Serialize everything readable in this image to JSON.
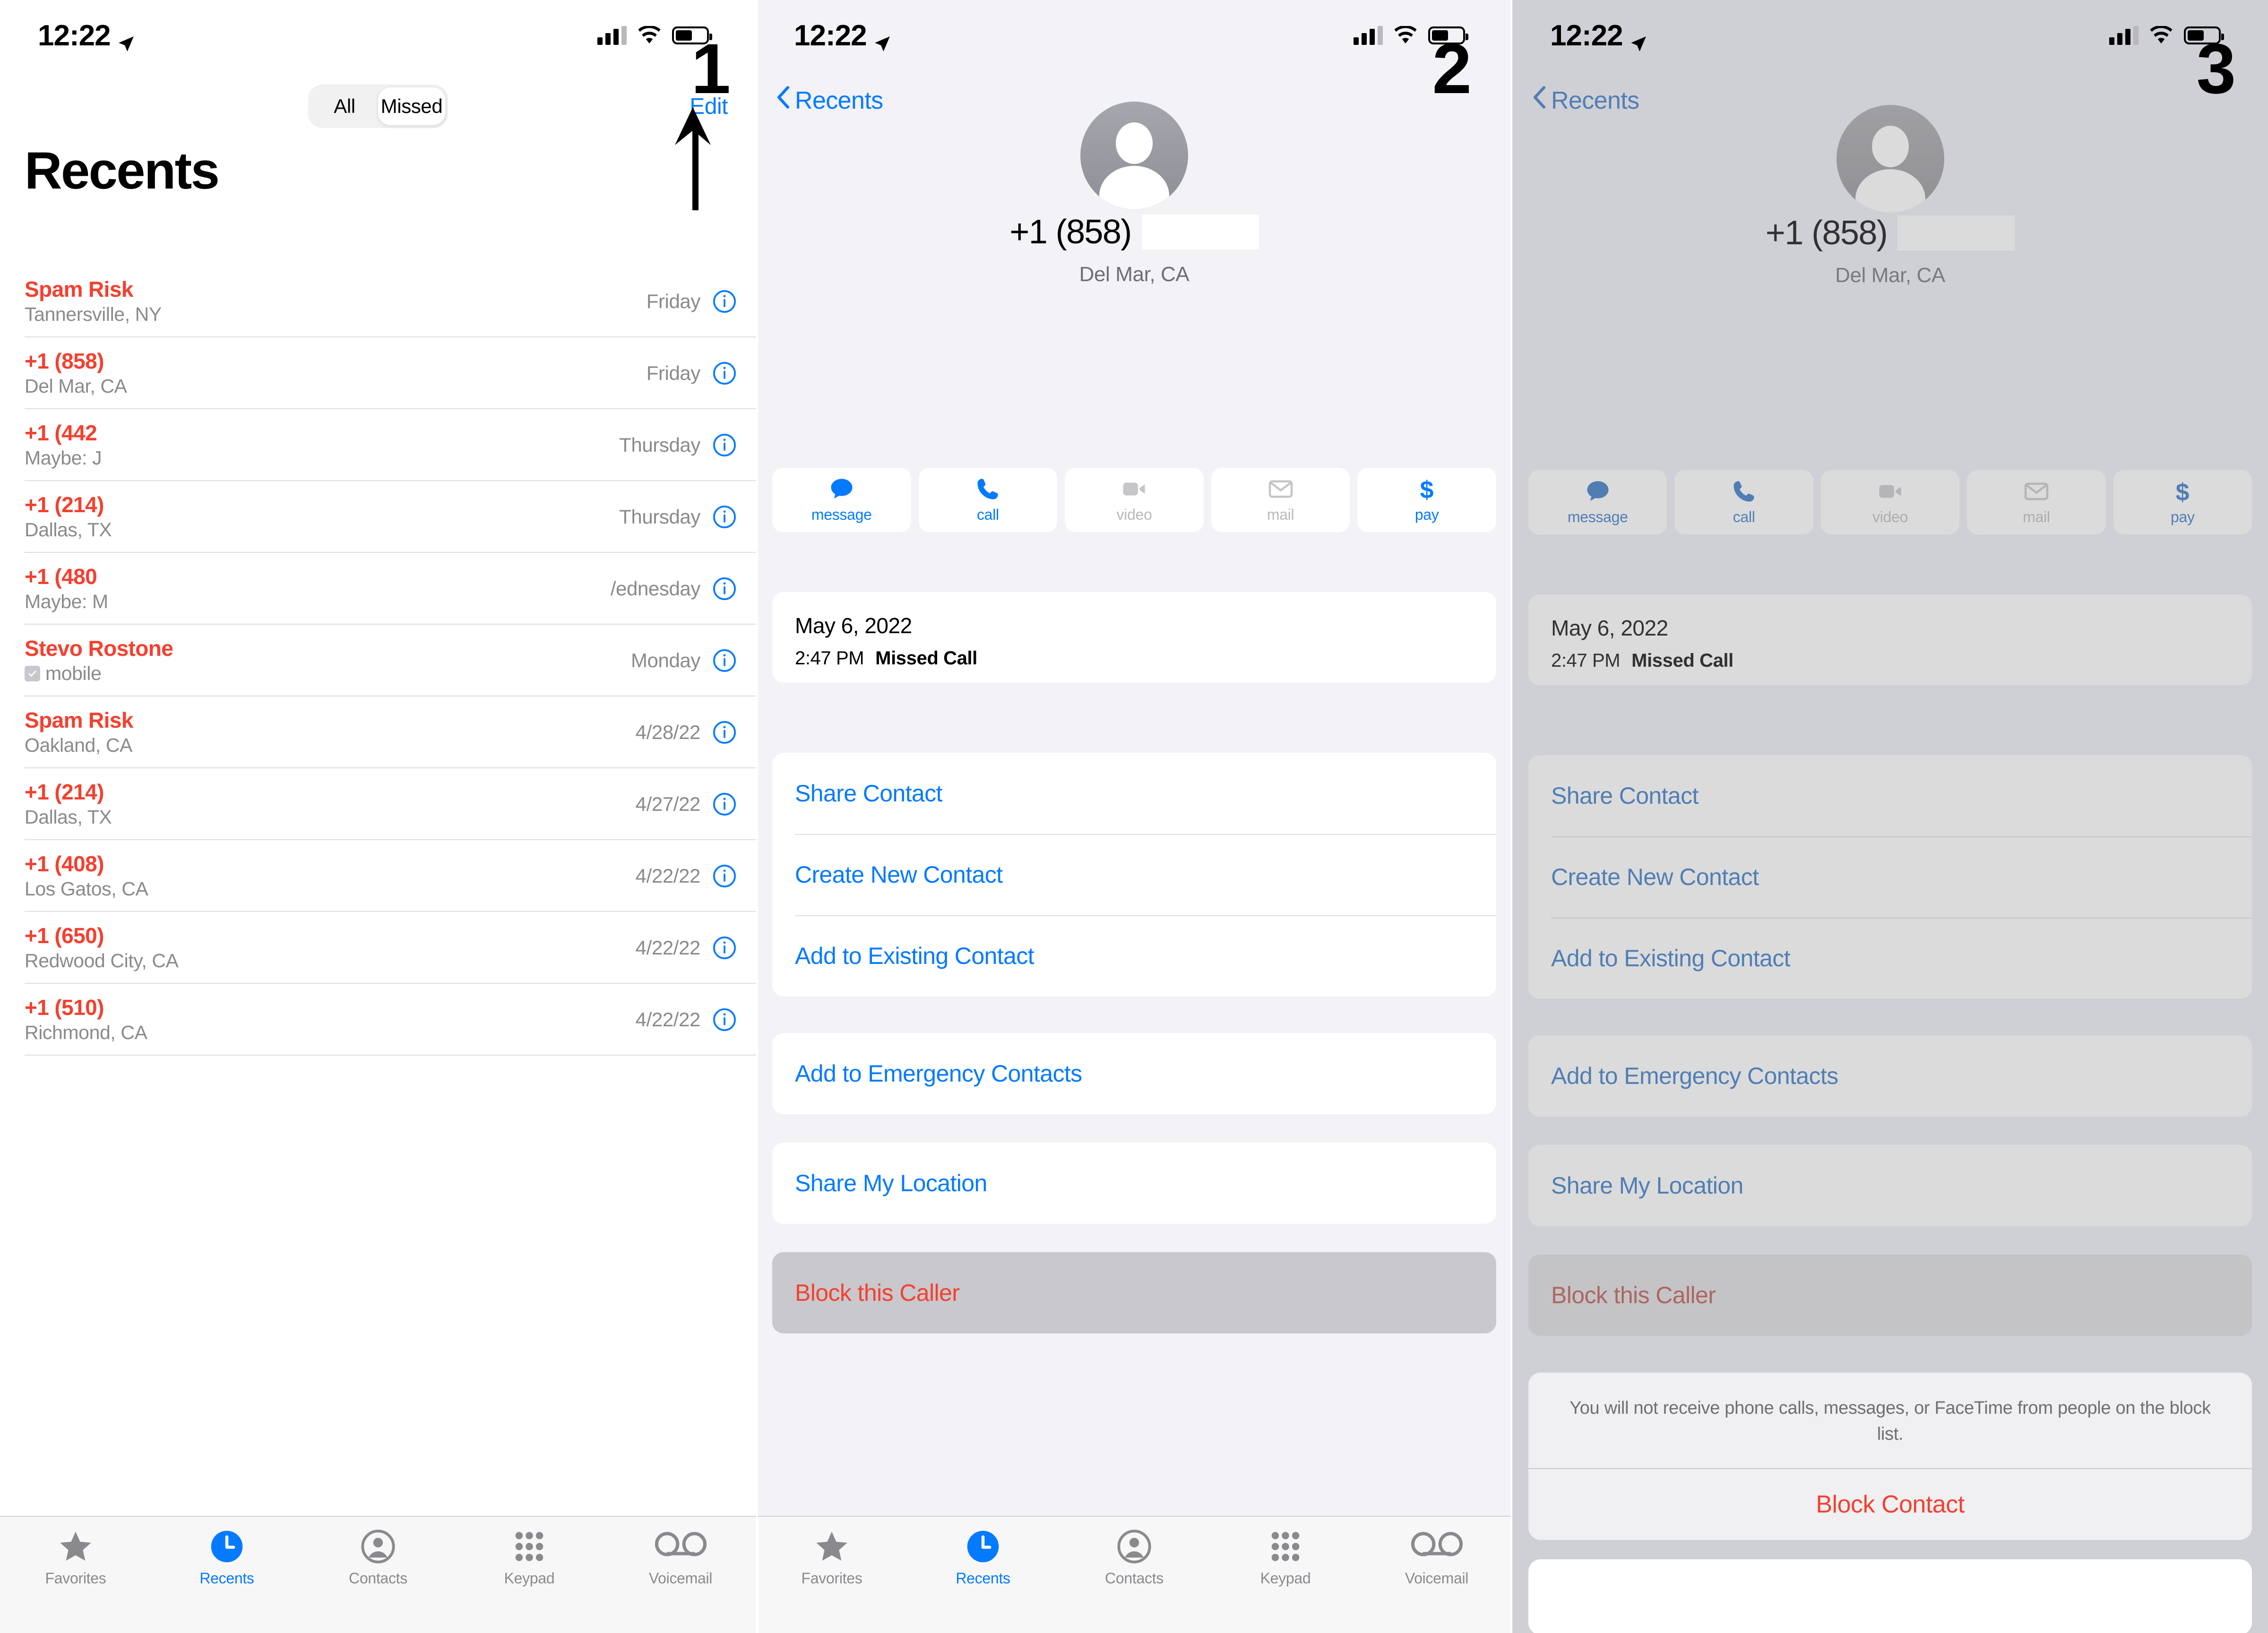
{
  "status_bar": {
    "time": "12:22",
    "location_arrow_icon": "location-arrow-icon",
    "signal_icon": "cellular-signal-icon",
    "wifi_icon": "wifi-icon",
    "battery_icon": "battery-icon"
  },
  "step_badges": {
    "one": "1",
    "two": "2",
    "three": "3"
  },
  "colors": {
    "accent_blue": "#047aff",
    "destructive_red": "#f4402f",
    "secondary_text": "#8a8a8e",
    "panel_bg": "#f2f2f7",
    "card_bg": "#ffffff",
    "pressed_row": "#c8c8cd"
  },
  "panel1": {
    "segmented": {
      "options": [
        "All",
        "Missed"
      ],
      "selected": "Missed"
    },
    "edit_label": "Edit",
    "page_title": "Recents",
    "calls": [
      {
        "name": "Spam Risk",
        "sub": "Tannersville, NY",
        "time": "Friday",
        "redacted": false,
        "checkbox": false
      },
      {
        "name": "+1 (858)",
        "sub": "Del Mar, CA",
        "time": "Friday",
        "redacted": false,
        "checkbox": false
      },
      {
        "name": "+1 (442",
        "sub": "Maybe: J",
        "time": "Thursday",
        "redacted": true,
        "checkbox": false
      },
      {
        "name": "+1 (214)",
        "sub": "Dallas, TX",
        "time": "Thursday",
        "redacted": false,
        "checkbox": false
      },
      {
        "name": "+1 (480",
        "sub": "Maybe: M",
        "time": "/ednesday",
        "redacted": true,
        "checkbox": false
      },
      {
        "name": "Stevo Rostone",
        "sub": "mobile",
        "time": "Monday",
        "redacted": false,
        "checkbox": true
      },
      {
        "name": "Spam Risk",
        "sub": "Oakland, CA",
        "time": "4/28/22",
        "redacted": false,
        "checkbox": false
      },
      {
        "name": "+1 (214)",
        "sub": "Dallas, TX",
        "time": "4/27/22",
        "redacted": false,
        "checkbox": false
      },
      {
        "name": "+1 (408)",
        "sub": "Los Gatos, CA",
        "time": "4/22/22",
        "redacted": false,
        "checkbox": false
      },
      {
        "name": "+1 (650)",
        "sub": "Redwood City, CA",
        "time": "4/22/22",
        "redacted": false,
        "checkbox": false
      },
      {
        "name": "+1 (510)",
        "sub": "Richmond, CA",
        "time": "4/22/22",
        "redacted": false,
        "checkbox": false
      }
    ],
    "info_icon": "info-circle-icon"
  },
  "tabbar": {
    "items": [
      {
        "label": "Favorites",
        "icon": "star-icon",
        "active": false
      },
      {
        "label": "Recents",
        "icon": "clock-icon",
        "active": true
      },
      {
        "label": "Contacts",
        "icon": "person-icon",
        "active": false
      },
      {
        "label": "Keypad",
        "icon": "keypad-icon",
        "active": false
      },
      {
        "label": "Voicemail",
        "icon": "voicemail-icon",
        "active": false
      }
    ]
  },
  "detail": {
    "back_label": "Recents",
    "back_icon": "chevron-left-icon",
    "avatar_icon": "person-avatar-icon",
    "phone_number": "+1 (858)",
    "location": "Del Mar, CA",
    "actions": [
      {
        "label": "message",
        "icon": "message-bubble-icon",
        "enabled": true
      },
      {
        "label": "call",
        "icon": "phone-icon",
        "enabled": true
      },
      {
        "label": "video",
        "icon": "video-camera-icon",
        "enabled": false
      },
      {
        "label": "mail",
        "icon": "envelope-icon",
        "enabled": false
      },
      {
        "label": "pay",
        "icon": "dollar-sign-icon",
        "enabled": true
      }
    ],
    "call_date": "May 6, 2022",
    "call_time": "2:47 PM",
    "call_type": "Missed Call",
    "contact_actions": [
      "Share Contact",
      "Create New Contact",
      "Add to Existing Contact"
    ],
    "emergency_action": "Add to Emergency Contacts",
    "location_action": "Share My Location",
    "block_action": "Block this Caller"
  },
  "block_sheet": {
    "message": "You will not receive phone calls, messages, or FaceTime from people on the block list.",
    "confirm_label": "Block Contact"
  }
}
